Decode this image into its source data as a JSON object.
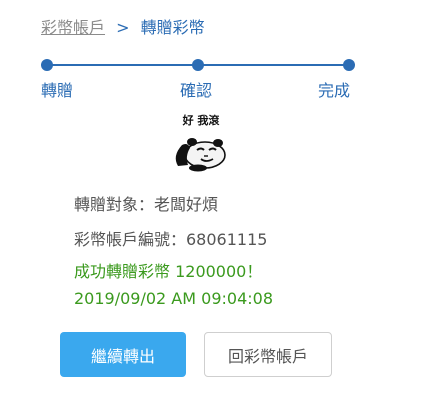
{
  "breadcrumb": {
    "parent": "彩幣帳戶",
    "separator": ">",
    "current": "轉贈彩幣"
  },
  "steps": [
    {
      "label": "轉贈"
    },
    {
      "label": "確認"
    },
    {
      "label": "完成"
    }
  ],
  "sticker": {
    "caption": "好 我滾",
    "icon": "panda-meme-sticker"
  },
  "result": {
    "recipient": "轉贈對象：老闆好煩",
    "account": "彩幣帳戶編號：68061115",
    "success": "成功轉贈彩幣 1200000！",
    "timestamp": "2019/09/02 AM 09:04:08"
  },
  "buttons": {
    "continue": "繼續轉出",
    "back": "回彩幣帳戶"
  },
  "colors": {
    "accent": "#2b6cb4",
    "primary_button": "#3aa8ee",
    "success": "#3b9a1e",
    "muted": "#8b8b8b"
  }
}
